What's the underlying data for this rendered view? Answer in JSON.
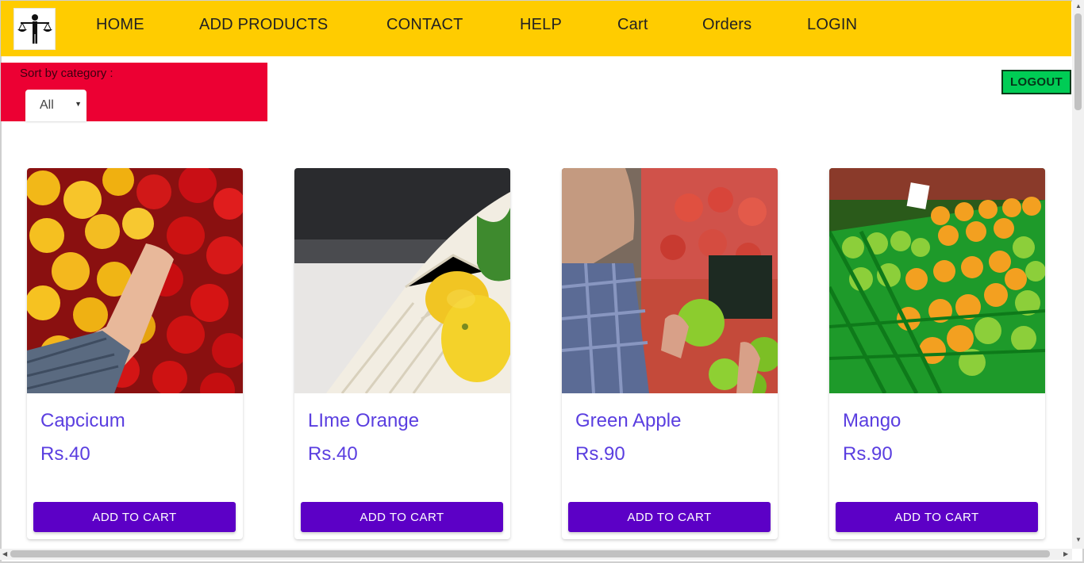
{
  "nav": {
    "logo_icon": "scale-person-logo",
    "items": [
      {
        "label": "HOME"
      },
      {
        "label": "ADD PRODUCTS"
      },
      {
        "label": "CONTACT"
      },
      {
        "label": "HELP"
      },
      {
        "label": "Cart"
      },
      {
        "label": "Orders"
      },
      {
        "label": "LOGIN"
      }
    ]
  },
  "filter": {
    "label": "Sort by category :",
    "selected": "All"
  },
  "logout": {
    "label": "LOGOUT"
  },
  "products": [
    {
      "name": "Capcicum",
      "price": "Rs.40",
      "button": "ADD TO CART"
    },
    {
      "name": "LIme Orange",
      "price": "Rs.40",
      "button": "ADD TO CART"
    },
    {
      "name": "Green Apple",
      "price": "Rs.90",
      "button": "ADD TO CART"
    },
    {
      "name": "Mango",
      "price": "Rs.90",
      "button": "ADD TO CART"
    }
  ],
  "colors": {
    "navbar": "#ffcc00",
    "category_panel": "#ec0033",
    "logout": "#00cc55",
    "product_text": "#5a3ee0",
    "add_to_cart": "#5c00c6"
  }
}
